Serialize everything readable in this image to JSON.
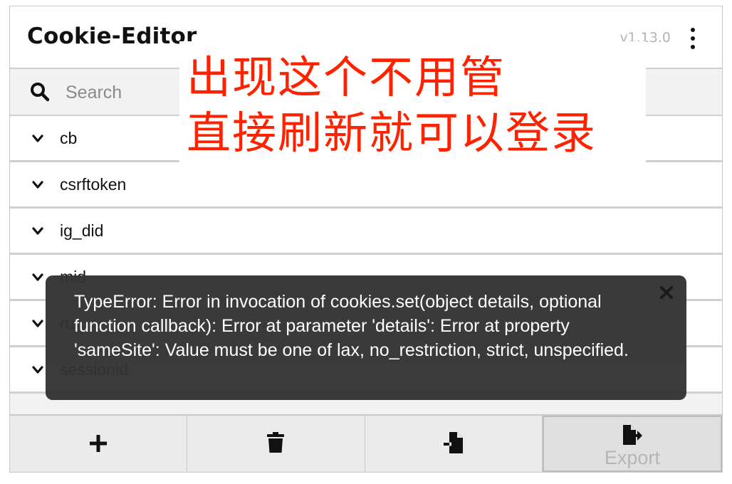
{
  "header": {
    "title": "Cookie-Editor",
    "version": "v1.13.0",
    "menu_icon": "more-vertical-icon"
  },
  "search": {
    "placeholder": "Search",
    "value": "",
    "icon": "search-icon"
  },
  "cookies": [
    {
      "name": "cb"
    },
    {
      "name": "csrftoken"
    },
    {
      "name": "ig_did"
    },
    {
      "name": "mid"
    },
    {
      "name": "rur"
    },
    {
      "name": "sessionid"
    }
  ],
  "toolbar": {
    "add_icon": "plus-icon",
    "delete_icon": "trash-icon",
    "import_icon": "file-import-icon",
    "export_icon": "file-export-icon",
    "export_label": "Export"
  },
  "error_toast": {
    "message": "TypeError: Error in invocation of cookies.set(object details, optional function callback): Error at parameter 'details': Error at property 'sameSite': Value must be one of lax, no_restriction, strict, unspecified.",
    "close_icon": "close-icon"
  },
  "annotation": {
    "line1": "出现这个不用管",
    "line2": "直接刷新就可以登录",
    "color": "#ff2200"
  },
  "colors": {
    "toast_bg": "#333333",
    "annotation_red": "#ff2200",
    "border": "#d0d0d0"
  }
}
